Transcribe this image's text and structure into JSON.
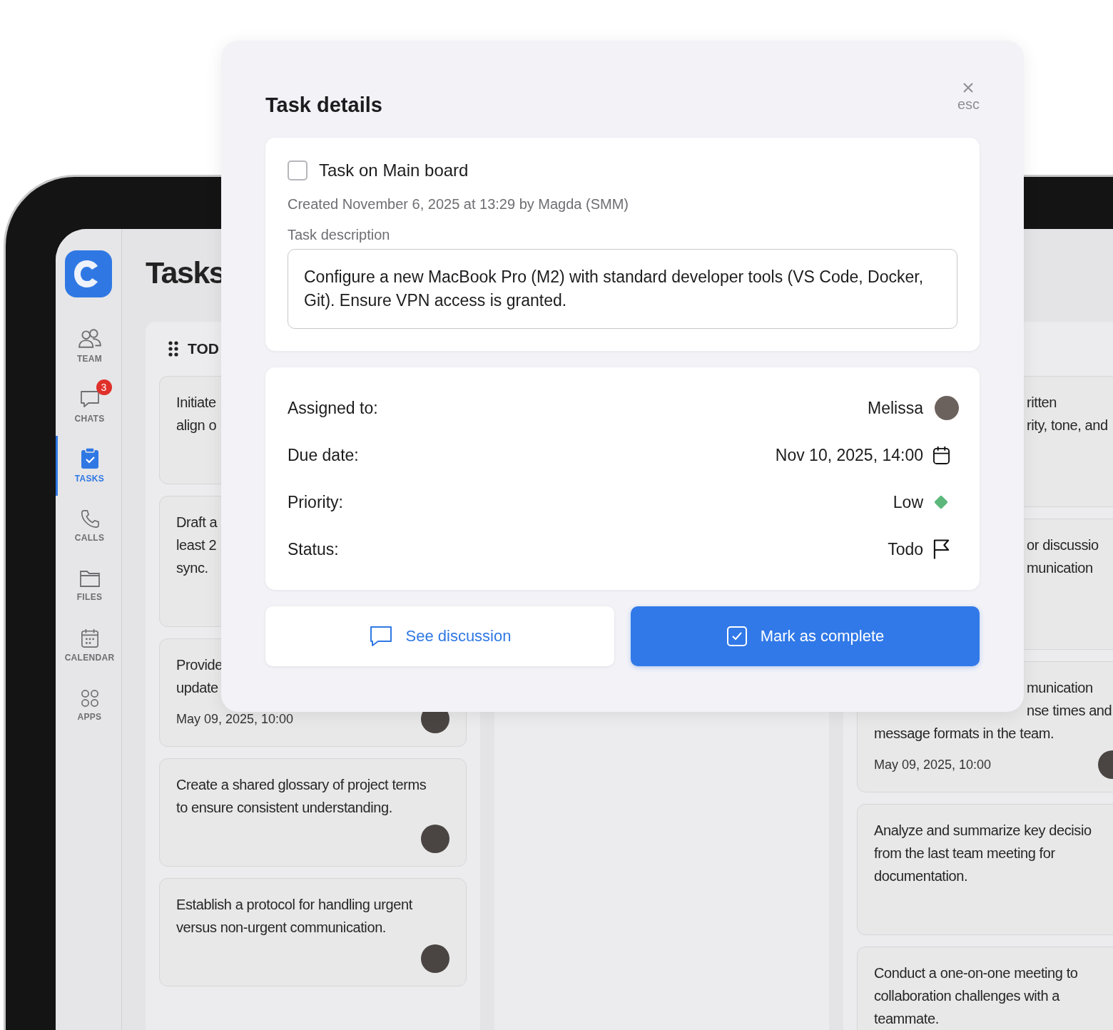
{
  "sidebar": {
    "items": [
      {
        "kind": "team",
        "label": "TEAM",
        "selected": false
      },
      {
        "kind": "chats",
        "label": "CHATS",
        "badge": "3",
        "selected": false
      },
      {
        "kind": "tasks",
        "label": "TASKS",
        "selected": true
      },
      {
        "kind": "calls",
        "label": "CALLS",
        "selected": false
      },
      {
        "kind": "files",
        "label": "FILES",
        "selected": false
      },
      {
        "kind": "calendar",
        "label": "CALENDAR",
        "selected": false
      },
      {
        "kind": "apps",
        "label": "APPS",
        "selected": false
      }
    ]
  },
  "page": {
    "title": "Tasks"
  },
  "board": {
    "left_column": {
      "title": "TOD",
      "cards": [
        {
          "lines": [
            "Initiate",
            "align o"
          ],
          "avatar": false
        },
        {
          "lines": [
            "Draft a",
            "least 2",
            "sync."
          ],
          "avatar": false
        },
        {
          "lines": [
            "Provide",
            "update"
          ],
          "date": "May 09, 2025, 10:00",
          "avatar": true
        },
        {
          "lines": [
            "Create a shared glossary of project terms",
            "to ensure consistent understanding."
          ],
          "avatar": true
        },
        {
          "lines": [
            "Establish a protocol for handling urgent",
            "versus non-urgent communication."
          ],
          "avatar": true
        }
      ]
    },
    "right_column": {
      "cards": [
        {
          "covered_lines": [
            "ritten",
            "rity, tone, and"
          ],
          "avatar": false
        },
        {
          "covered_lines": [
            "or discussio",
            "munication"
          ],
          "avatar": false
        },
        {
          "covered_lines": [
            "munication",
            "nse times and"
          ],
          "lines": [
            "message formats in the team."
          ],
          "date": "May 09, 2025, 10:00",
          "avatar": true
        },
        {
          "lines": [
            "Analyze and summarize key decisio",
            "from the last team meeting for",
            "documentation."
          ],
          "avatar": false
        },
        {
          "lines": [
            "Conduct a one-on-one meeting to",
            "collaboration challenges with a",
            "teammate."
          ],
          "avatar": false
        }
      ]
    }
  },
  "modal": {
    "title": "Task details",
    "close_hint": "esc",
    "task": {
      "checked": false,
      "title": "Task on Main board",
      "created": "Created November 6, 2025 at 13:29 by Magda (SMM)",
      "description_label": "Task description",
      "description": "Configure a new MacBook Pro (M2) with standard developer tools (VS Code, Docker, Git). Ensure VPN access is granted."
    },
    "fields": [
      {
        "kind": "assignee",
        "label": "Assigned to:",
        "value": "Melissa"
      },
      {
        "kind": "date",
        "label": "Due date:",
        "value": "Nov 10, 2025, 14:00"
      },
      {
        "kind": "priority",
        "label": "Priority:",
        "value": "Low"
      },
      {
        "kind": "status",
        "label": "Status:",
        "value": "Todo"
      }
    ],
    "buttons": [
      {
        "kind": "secondary",
        "label": "See discussion"
      },
      {
        "kind": "primary",
        "label": "Mark as complete"
      }
    ]
  }
}
